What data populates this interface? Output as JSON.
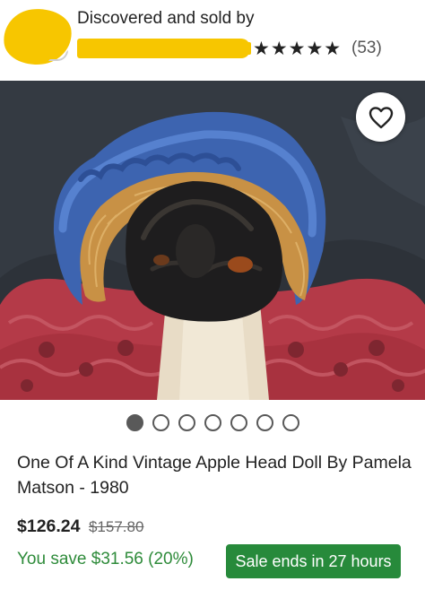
{
  "seller": {
    "discovered_label": "Discovered and sold by",
    "name_redacted": true,
    "rating_stars": "★★★★★",
    "rating_value": 5,
    "review_count": "(53)"
  },
  "listing": {
    "image_alt": "Apple head doll photo",
    "favorite_icon": "heart-outline-icon",
    "image_count": 7,
    "active_image": 1,
    "title": "One Of A Kind Vintage Apple Head Doll By Pamela Matson - 1980",
    "price": "$126.24",
    "original_price": "$157.80",
    "savings": "You save $31.56 (20%)",
    "sale_badge": "Sale ends in 27 hours"
  },
  "colors": {
    "savings_green": "#2e8b3a",
    "badge_green": "#278a3b",
    "redaction_yellow": "#f7c600"
  }
}
